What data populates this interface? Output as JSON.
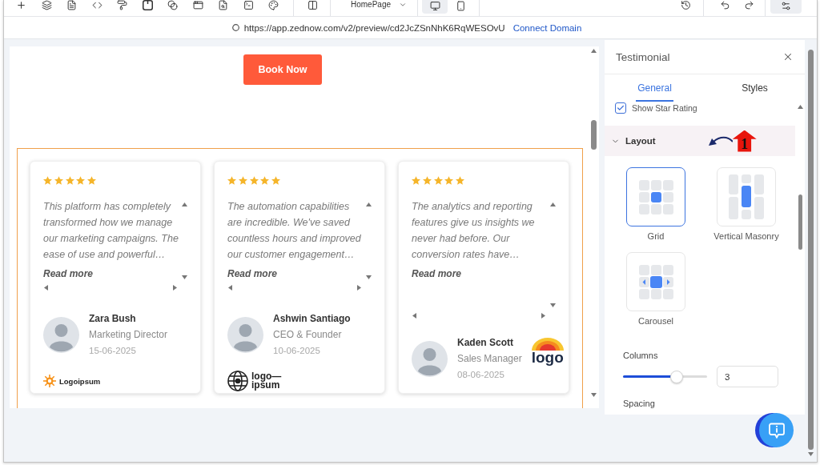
{
  "toolbar": {
    "page_select": "HomePage",
    "devices": [
      {
        "kind": "desktop",
        "selected": true
      },
      {
        "kind": "mobile",
        "selected": false
      }
    ],
    "settings_active": true
  },
  "address_bar": {
    "url": "https://app.zednow.com/v2/preview/cd2JcZSnNhK6RqWESOvU",
    "link": "Connect Domain"
  },
  "canvas": {
    "button": "Book Now",
    "testimonials": [
      {
        "kind": "stacked",
        "stars": 5,
        "text": "This platform has completely transformed how we manage our marketing campaigns. The ease of use and powerful…",
        "read_more": "Read more",
        "name": "Zara Bush",
        "role": "Marketing Director",
        "date": "15-06-2025",
        "logo": {
          "kind": "sun",
          "lines": [
            "Logoipsum"
          ]
        }
      },
      {
        "kind": "stacked",
        "stars": 5,
        "text": "The automation capabilities are incredible. We've saved countless hours and improved our customer engagement…",
        "read_more": "Read more",
        "name": "Ashwin Santiago",
        "role": "CEO & Founder",
        "date": "10-06-2025",
        "logo": {
          "kind": "globe",
          "lines": [
            "logo—",
            "ipsum"
          ]
        }
      },
      {
        "kind": "side",
        "stars": 5,
        "text": "The analytics and reporting features give us insights we never had before. Our conversion rates have…",
        "read_more": "Read more",
        "name": "Kaden Scott",
        "role": "Sales Manager",
        "date": "08-06-2025",
        "logo": {
          "kind": "rainbow",
          "lines": [
            "logo"
          ]
        }
      }
    ]
  },
  "panel": {
    "title": "Testimonial",
    "tabs": [
      {
        "label": "General",
        "selected": true
      },
      {
        "label": "Styles",
        "selected": false
      }
    ],
    "show_star_rating": {
      "label": "Show Star Rating",
      "checked": true
    },
    "section": {
      "title": "Layout",
      "expanded": true
    },
    "annotation": {
      "label": "1"
    },
    "layouts": [
      {
        "kind": "grid",
        "label": "Grid",
        "selected": true
      },
      {
        "kind": "masonry",
        "label": "Vertical Masonry",
        "selected": false
      },
      {
        "kind": "carousel",
        "label": "Carousel",
        "selected": false
      }
    ],
    "columns": {
      "label": "Columns",
      "level": 0.64,
      "value": "3"
    },
    "spacing": {
      "label": "Spacing"
    }
  }
}
